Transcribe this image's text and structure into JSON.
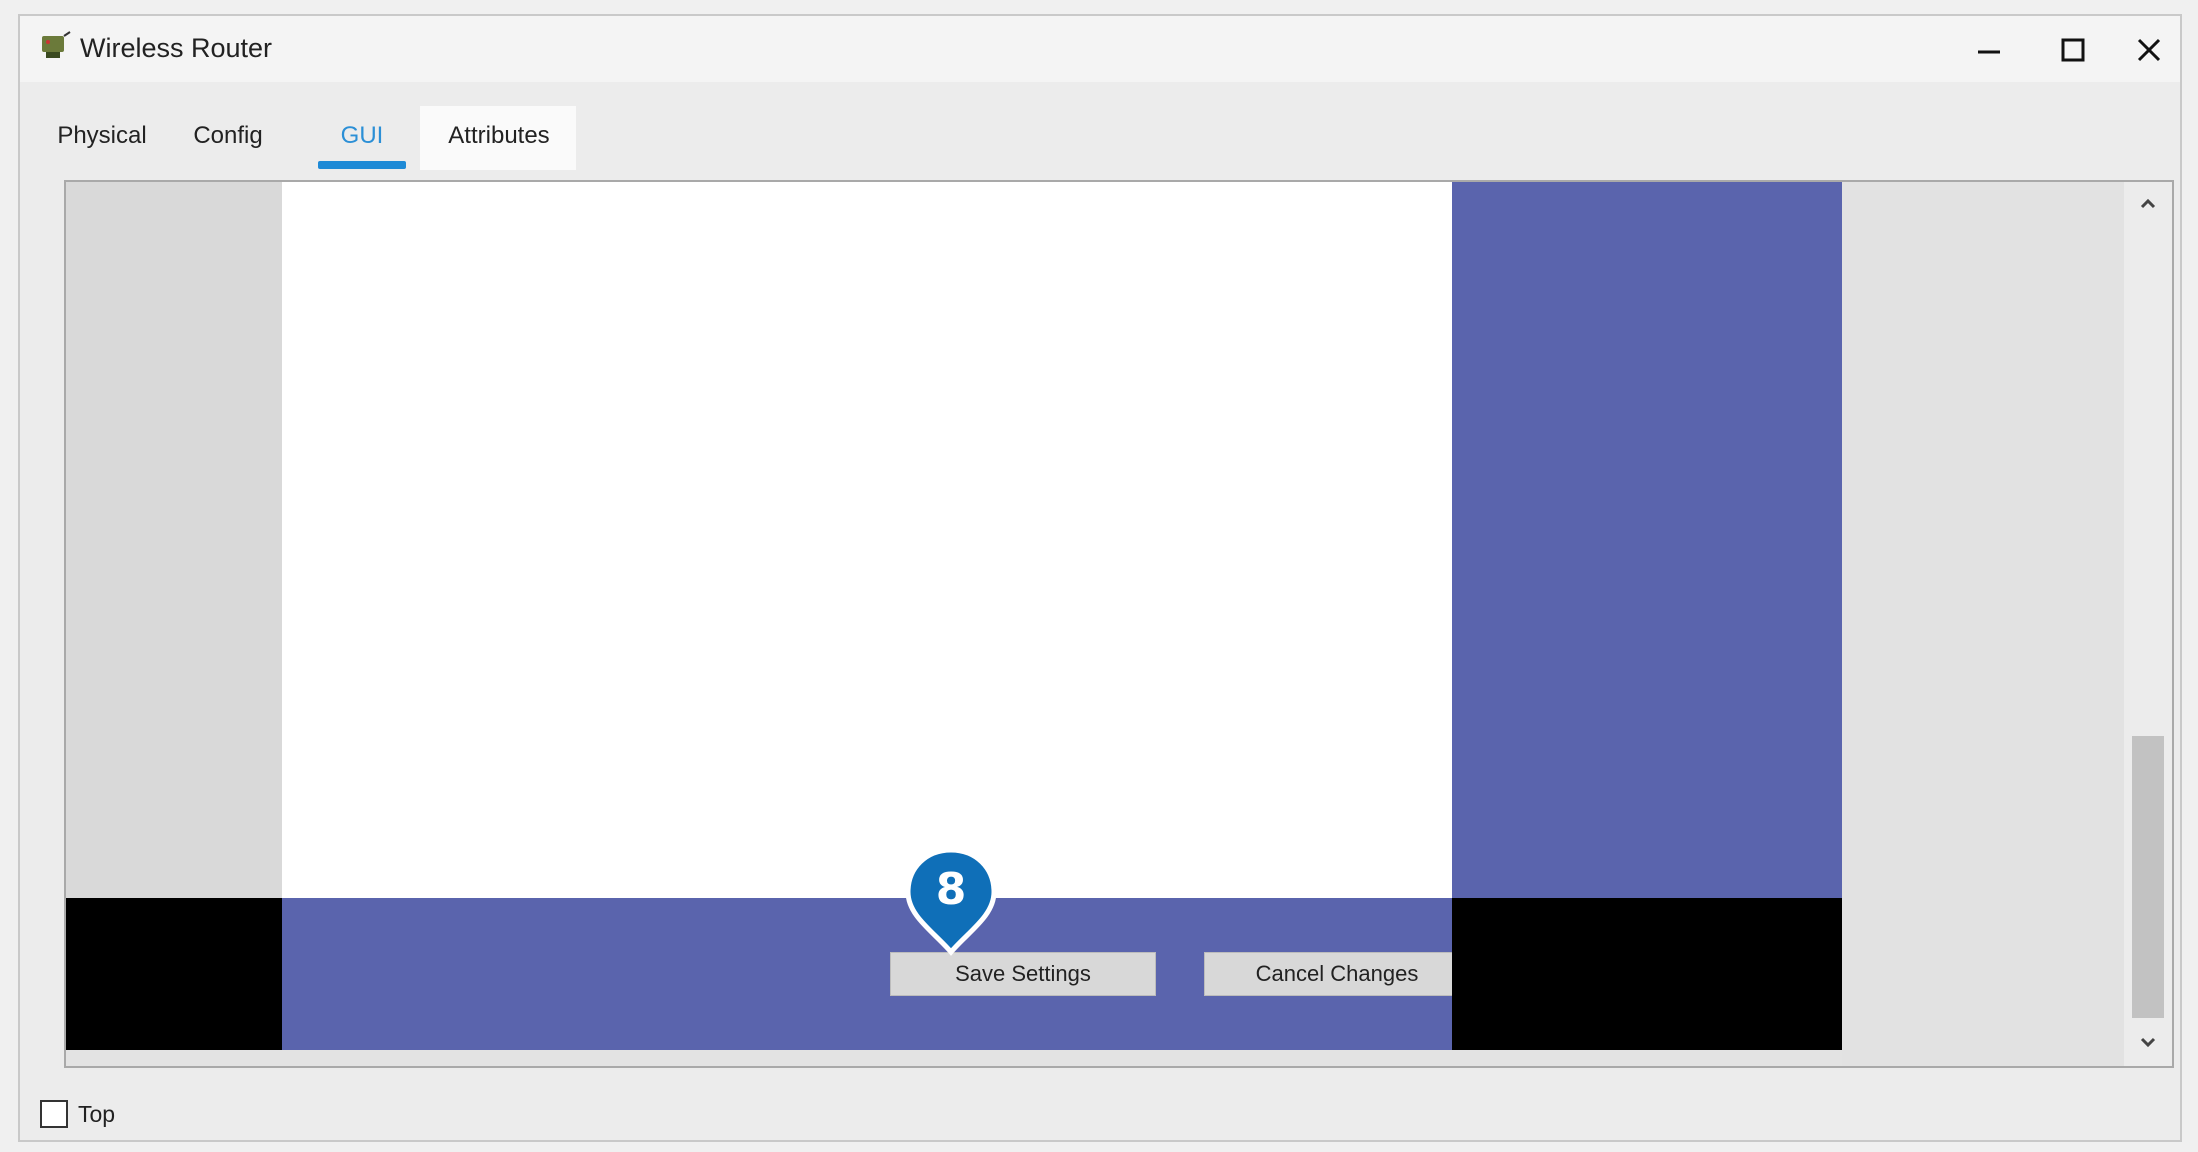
{
  "window": {
    "title": "Wireless Router",
    "app_icon": "router-app-icon",
    "controls": [
      "minimize-icon",
      "maximize-icon",
      "close-icon"
    ]
  },
  "tabs": [
    {
      "label": "Physical",
      "active": false
    },
    {
      "label": "Config",
      "active": false
    },
    {
      "label": "GUI",
      "active": true
    },
    {
      "label": "Attributes",
      "active": false
    }
  ],
  "gui": {
    "save_button": "Save Settings",
    "cancel_button": "Cancel Changes",
    "step_badge": "8"
  },
  "footer": {
    "checkbox_label": "Top",
    "checkbox_checked": false
  },
  "colors": {
    "accent": "#1e8ad6",
    "panel_blue": "#5a64ad",
    "badge_blue": "#0f6fb8",
    "black": "#000000"
  }
}
